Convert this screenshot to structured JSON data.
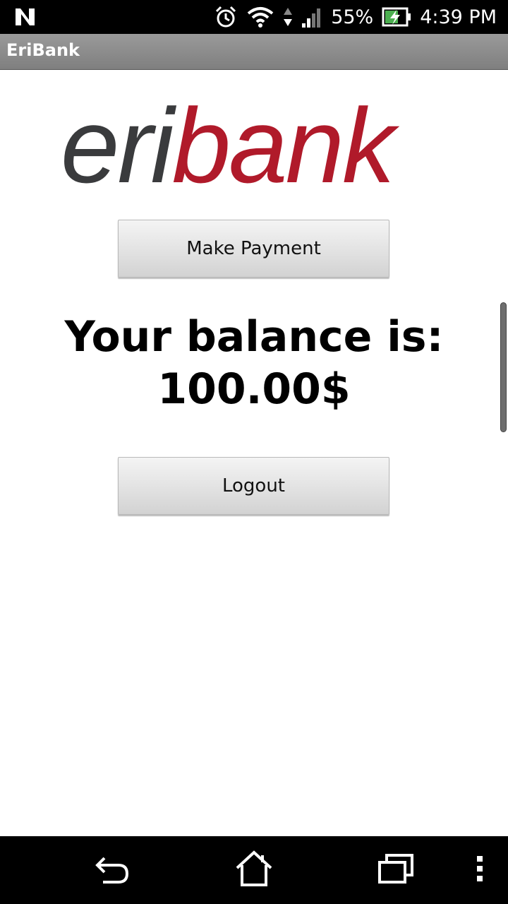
{
  "status_bar": {
    "notification_icon": "n-notification-icon",
    "alarm_icon": "alarm-clock-icon",
    "wifi_icon": "wifi-icon",
    "data_icon": "data-transfer-icon",
    "signal_icon": "cell-signal-icon",
    "battery_percent": "55%",
    "battery_icon": "battery-charging-icon",
    "time": "4:39 PM"
  },
  "app_bar": {
    "title": "EriBank"
  },
  "logo": {
    "text_part1": "eri",
    "text_part2": "bank",
    "colors": {
      "part1": "#3a3b3d",
      "part2": "#b01a2a"
    }
  },
  "main": {
    "make_payment_label": "Make Payment",
    "balance_label": "Your balance is:",
    "balance_value": "100.00$",
    "logout_label": "Logout"
  },
  "nav_bar": {
    "back_icon": "back-icon",
    "home_icon": "home-icon",
    "recents_icon": "recent-apps-icon",
    "menu_icon": "overflow-menu-icon"
  }
}
